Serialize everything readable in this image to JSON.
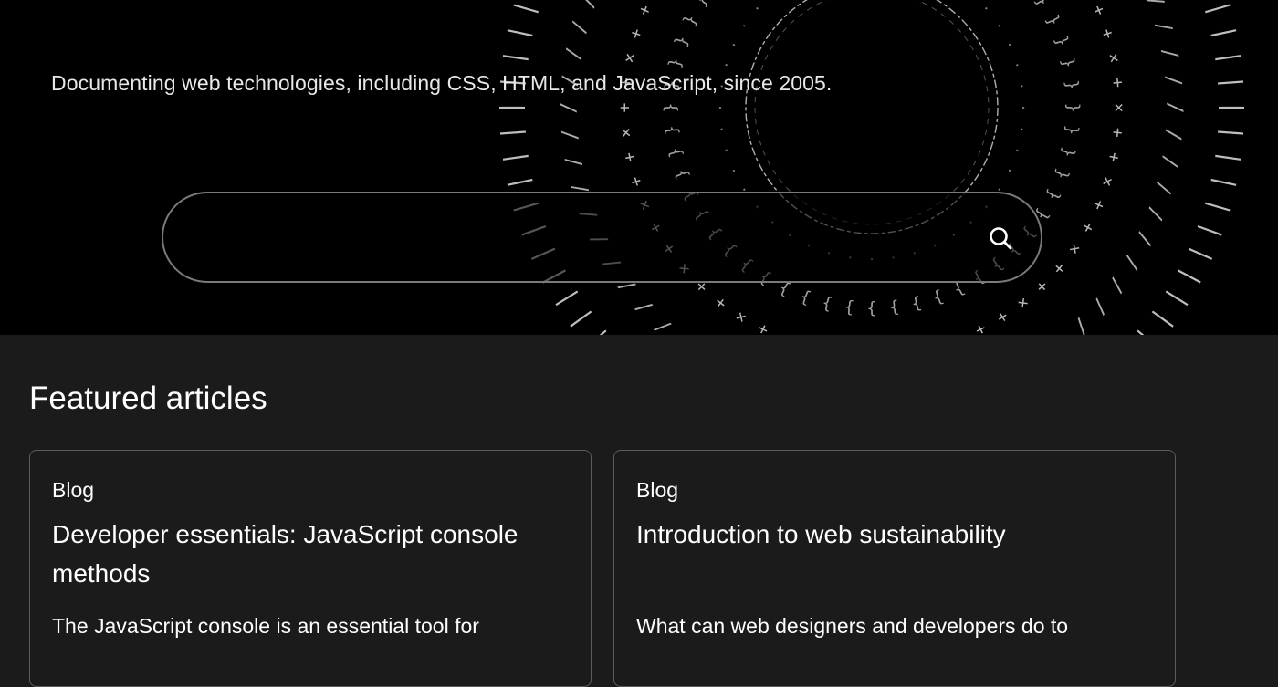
{
  "hero": {
    "tagline": "Documenting web technologies, including CSS, HTML, and JavaScript, since 2005.",
    "search": {
      "placeholder": "",
      "value": "",
      "icon": "search-icon"
    }
  },
  "featured": {
    "title": "Featured articles",
    "cards": [
      {
        "tag": "Blog",
        "title": "Developer essentials: JavaScript console methods",
        "excerpt": "The JavaScript console is an essential tool for"
      },
      {
        "tag": "Blog",
        "title": "Introduction to web sustainability",
        "excerpt": "What can web designers and developers do to"
      }
    ]
  },
  "colors": {
    "hero_bg": "#000000",
    "page_bg": "#1b1b1b",
    "card_border": "#5c5c5c",
    "text": "#ffffff"
  }
}
